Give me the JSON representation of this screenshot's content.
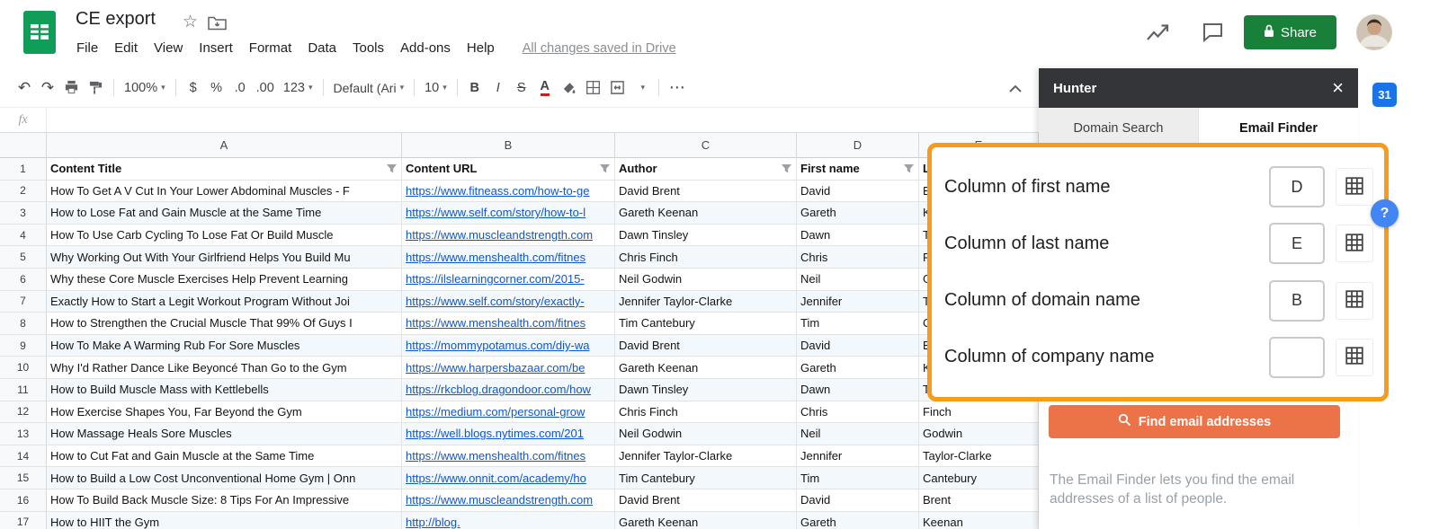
{
  "titlebar": {
    "doc_title": "CE export",
    "menus": [
      "File",
      "Edit",
      "View",
      "Insert",
      "Format",
      "Data",
      "Tools",
      "Add-ons",
      "Help"
    ],
    "save_status": "All changes saved in Drive",
    "share_label": "Share"
  },
  "toolbar": {
    "zoom": "100%",
    "currency": "$",
    "percent": "%",
    "decimal_decrease": ".0",
    "decimal_increase": ".00",
    "number_format": "123",
    "font_name": "Default (Ari",
    "font_size": "10",
    "bold": "B",
    "italic": "I",
    "strikethrough": "S",
    "text_color": "A"
  },
  "icons": {
    "undo": "↶",
    "redo": "↷",
    "dropdown": "▾",
    "more": "⋯",
    "star": "☆",
    "close": "×"
  },
  "formula_bar": {
    "label": "fx"
  },
  "sheet": {
    "column_letters": [
      "A",
      "B",
      "C",
      "D",
      "E"
    ],
    "header_row": {
      "n": "1",
      "title": "Content Title",
      "url": "Content URL",
      "author": "Author",
      "first": "First name",
      "last": "Last name"
    },
    "rows": [
      {
        "n": 2,
        "title": "How To Get A V Cut In Your Lower Abdominal Muscles - F",
        "url": "https://www.fitneass.com/how-to-ge",
        "author": "David Brent",
        "first": "David",
        "last": "Brent"
      },
      {
        "n": 3,
        "title": "How to Lose Fat and Gain Muscle at the Same Time",
        "url": "https://www.self.com/story/how-to-l",
        "author": "Gareth Keenan",
        "first": "Gareth",
        "last": "Keenan"
      },
      {
        "n": 4,
        "title": "How To Use Carb Cycling To Lose Fat Or Build Muscle",
        "url": "https://www.muscleandstrength.com",
        "author": "Dawn Tinsley",
        "first": "Dawn",
        "last": "Tinsley"
      },
      {
        "n": 5,
        "title": "Why Working Out With Your Girlfriend Helps You Build Mu",
        "url": "https://www.menshealth.com/fitnes",
        "author": "Chris Finch",
        "first": "Chris",
        "last": "Finch"
      },
      {
        "n": 6,
        "title": "Why these Core Muscle Exercises Help Prevent Learning",
        "url": "https://ilslearningcorner.com/2015-",
        "author": "Neil Godwin",
        "first": "Neil",
        "last": "Godwin"
      },
      {
        "n": 7,
        "title": "Exactly How to Start a Legit Workout Program Without Joi",
        "url": "https://www.self.com/story/exactly-",
        "author": "Jennifer Taylor-Clarke",
        "first": "Jennifer",
        "last": "Taylor-Clarke"
      },
      {
        "n": 8,
        "title": "How to Strengthen the Crucial Muscle That 99% Of Guys I",
        "url": "https://www.menshealth.com/fitnes",
        "author": "Tim Cantebury",
        "first": "Tim",
        "last": "Cantebury"
      },
      {
        "n": 9,
        "title": "How To Make A Warming Rub For Sore Muscles",
        "url": "https://mommypotamus.com/diy-wa",
        "author": "David Brent",
        "first": "David",
        "last": "Brent"
      },
      {
        "n": 10,
        "title": "Why I'd Rather Dance Like Beyoncé Than Go to the Gym",
        "url": "https://www.harpersbazaar.com/be",
        "author": "Gareth Keenan",
        "first": "Gareth",
        "last": "Keenan"
      },
      {
        "n": 11,
        "title": "How to Build Muscle Mass with Kettlebells",
        "url": "https://rkcblog.dragondoor.com/how",
        "author": "Dawn Tinsley",
        "first": "Dawn",
        "last": "Tinsley"
      },
      {
        "n": 12,
        "title": "How Exercise Shapes You, Far Beyond the Gym",
        "url": "https://medium.com/personal-grow",
        "author": "Chris Finch",
        "first": "Chris",
        "last": "Finch"
      },
      {
        "n": 13,
        "title": "How Massage Heals Sore Muscles",
        "url": "https://well.blogs.nytimes.com/201",
        "author": "Neil Godwin",
        "first": "Neil",
        "last": "Godwin"
      },
      {
        "n": 14,
        "title": "How to Cut Fat and Gain Muscle at the Same Time",
        "url": "https://www.menshealth.com/fitnes",
        "author": "Jennifer Taylor-Clarke",
        "first": "Jennifer",
        "last": "Taylor-Clarke"
      },
      {
        "n": 15,
        "title": "How to Build a Low Cost Unconventional Home Gym | Onn",
        "url": "https://www.onnit.com/academy/ho",
        "author": "Tim Cantebury",
        "first": "Tim",
        "last": "Cantebury"
      },
      {
        "n": 16,
        "title": "How To Build Back Muscle Size: 8 Tips For An Impressive",
        "url": "https://www.muscleandstrength.com",
        "author": "David Brent",
        "first": "David",
        "last": "Brent"
      },
      {
        "n": 17,
        "title": "How to HIIT the Gym",
        "url": "http://blog.",
        "author": "Gareth Keenan",
        "first": "Gareth",
        "last": "Keenan"
      }
    ]
  },
  "panel": {
    "title": "Hunter",
    "tabs": [
      {
        "label": "Domain Search",
        "active": false
      },
      {
        "label": "Email Finder",
        "active": true
      }
    ],
    "fields": [
      {
        "label": "Column of first name",
        "value": "D"
      },
      {
        "label": "Column of last name",
        "value": "E"
      },
      {
        "label": "Column of domain name",
        "value": "B"
      },
      {
        "label": "Column of company name",
        "value": ""
      }
    ],
    "find_button_label": "Find email addresses",
    "description": "The Email Finder lets you find the email addresses of a list of people."
  },
  "floaters": {
    "calendar_badge": "31",
    "help_badge": "?"
  },
  "colors": {
    "annotation_orange": "#F79B1C",
    "find_button_orange": "#EB7347",
    "share_green": "#188038",
    "link_blue": "#1155CC",
    "sheets_green": "#0F9D58",
    "badge_blue": "#1A73E8",
    "panel_header_dark": "#333538",
    "row_band_blue": "#F3F8FC"
  }
}
